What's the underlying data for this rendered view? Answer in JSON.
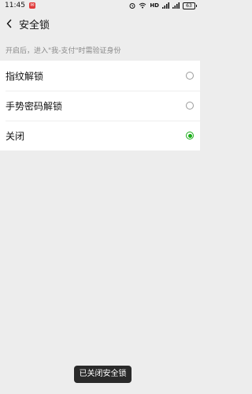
{
  "status_bar": {
    "time": "11:45",
    "network_label": "HD",
    "battery_level": "63"
  },
  "nav": {
    "title": "安全锁"
  },
  "hint": "开启后，进入\"我-支付\"时需验证身份",
  "options": [
    {
      "label": "指纹解锁",
      "selected": false
    },
    {
      "label": "手势密码解锁",
      "selected": false
    },
    {
      "label": "关闭",
      "selected": true
    }
  ],
  "toast": "已关闭安全锁",
  "colors": {
    "accent_green": "#1aad19",
    "background": "#ededed",
    "hint_text": "#8a8a8a"
  }
}
